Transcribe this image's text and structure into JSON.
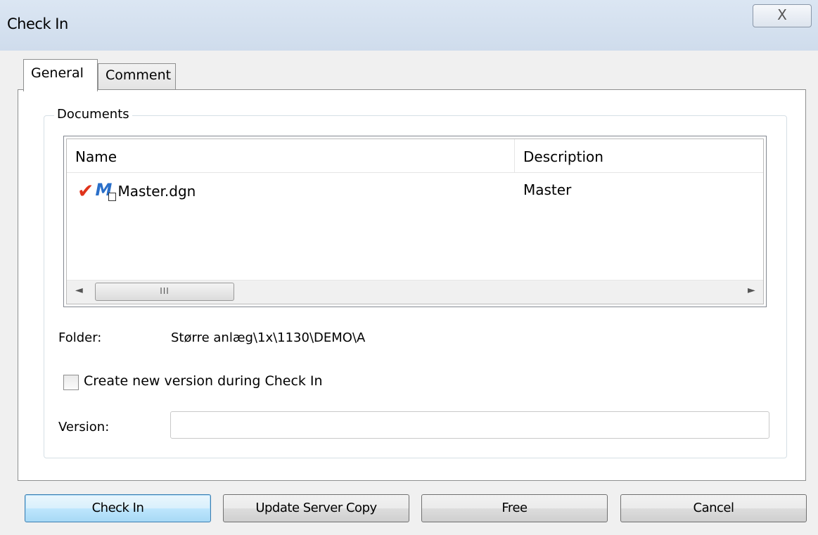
{
  "window": {
    "title": "Check In",
    "close_glyph": "X"
  },
  "tabs": [
    {
      "label": "General",
      "active": true
    },
    {
      "label": "Comment",
      "active": false
    }
  ],
  "documents_group": {
    "legend": "Documents",
    "columns": [
      "Name",
      "Description"
    ],
    "rows": [
      {
        "name": "Master.dgn",
        "description": "Master",
        "status_icon": "checkmark-icon",
        "type_icon": "microstation-file-icon"
      }
    ],
    "scroll_thumb_grip": "III",
    "scroll_left_glyph": "◄",
    "scroll_right_glyph": "►"
  },
  "folder": {
    "label": "Folder:",
    "value": "Større anlæg\\1x\\1130\\DEMO\\A"
  },
  "create_version": {
    "label": "Create new version during Check In",
    "checked": false
  },
  "version": {
    "label": "Version:",
    "value": ""
  },
  "buttons": {
    "check_in": "Check In",
    "update_server_copy": "Update Server Copy",
    "free": "Free",
    "cancel": "Cancel"
  },
  "colors": {
    "titlebar": "#d5e1ef",
    "check_mark": "#e0331b",
    "default_button": "#bee6fd"
  }
}
